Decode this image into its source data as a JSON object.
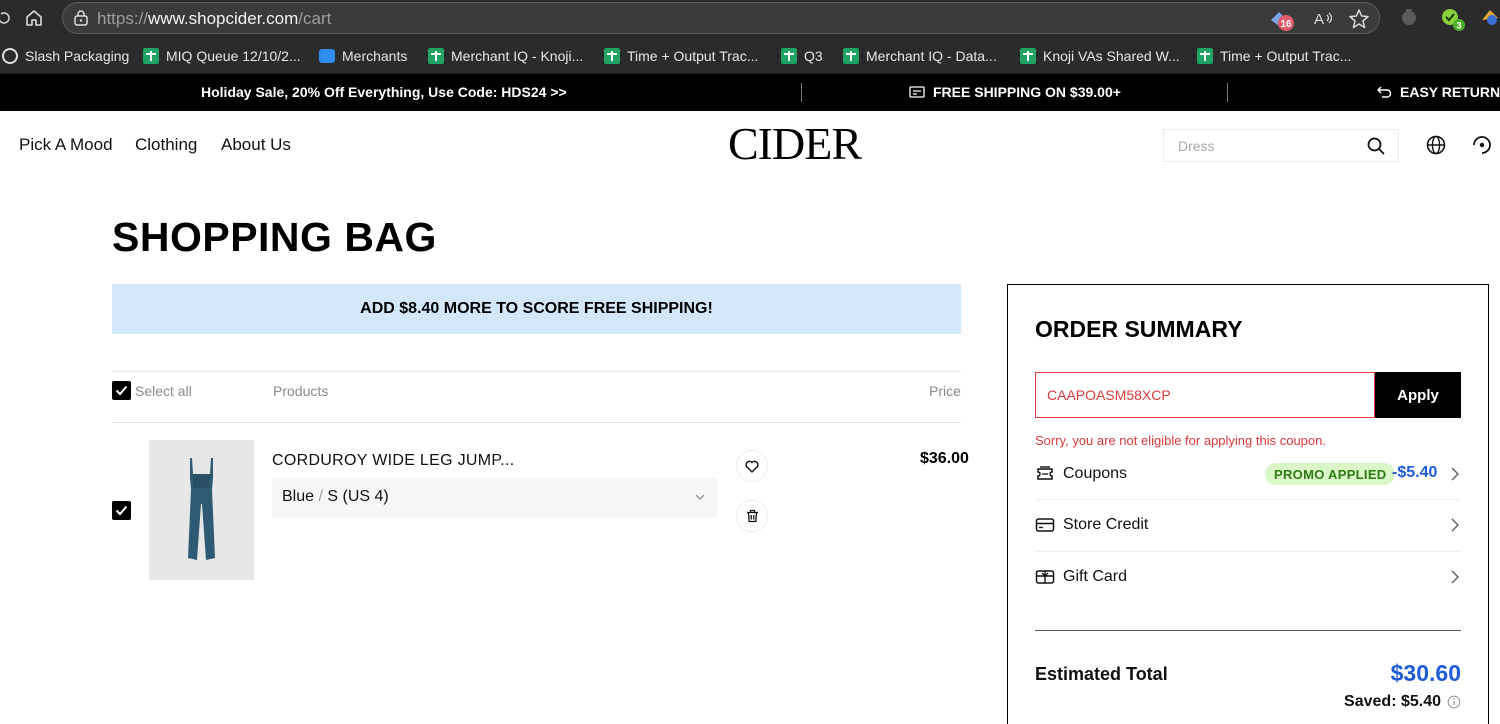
{
  "browser": {
    "url_prefix": "https://",
    "url_domain": "www.shopcider.com",
    "url_path": "/cart",
    "badge_count": "16",
    "ext_badge": "3"
  },
  "bookmarks": [
    {
      "label": "Slash Packaging",
      "icon": "globe-icon"
    },
    {
      "label": "MIQ Queue 12/10/2...",
      "icon": "sheets-icon"
    },
    {
      "label": "Merchants",
      "icon": "chat-icon"
    },
    {
      "label": "Merchant IQ - Knoji...",
      "icon": "sheets-icon"
    },
    {
      "label": "Time + Output Trac...",
      "icon": "sheets-icon"
    },
    {
      "label": "Q3",
      "icon": "sheets-icon"
    },
    {
      "label": "Merchant IQ - Data...",
      "icon": "sheets-icon"
    },
    {
      "label": "Knoji VAs Shared W...",
      "icon": "sheets-icon"
    },
    {
      "label": "Time + Output Trac...",
      "icon": "sheets-icon"
    }
  ],
  "promo": {
    "sale": "Holiday Sale, 20% Off Everything, Use Code: HDS24 >>",
    "shipping": "FREE SHIPPING ON $39.00+",
    "returns": "EASY RETURNS"
  },
  "header": {
    "nav": [
      "Pick A Mood",
      "Clothing",
      "About Us"
    ],
    "logo": "CIDER",
    "search_placeholder": "Dress"
  },
  "bag": {
    "title": "SHOPPING BAG",
    "shipping_banner": "ADD $8.40 MORE TO SCORE FREE SHIPPING!",
    "select_all": "Select all",
    "col_products": "Products",
    "col_price": "Price",
    "item": {
      "name": "CORDUROY WIDE LEG JUMP...",
      "color": "Blue",
      "separator": "/",
      "size": "S (US 4)",
      "price": "$36.00"
    }
  },
  "summary": {
    "title": "ORDER SUMMARY",
    "coupon_code": "CAAPOASM58XCP",
    "apply": "Apply",
    "error": "Sorry, you are not eligible for applying this coupon.",
    "coupons_label": "Coupons",
    "promo_tag": "PROMO APPLIED",
    "discount": "-$5.40",
    "store_credit_label": "Store Credit",
    "gift_card_label": "Gift Card",
    "estimated_total_label": "Estimated Total",
    "estimated_total": "$30.60",
    "saved": "Saved: $5.40"
  },
  "colors": {
    "accent_blue": "#1f5bd6",
    "error_red": "#d73a3a",
    "banner_blue": "#d3e7fb",
    "promo_green": "#daf7c7"
  }
}
